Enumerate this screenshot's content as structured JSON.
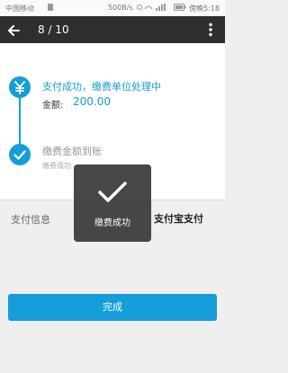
{
  "status_bar": {
    "carrier": "中国移动",
    "network_speed": "500B/s",
    "clock": "傍晚5:18"
  },
  "top_bar": {
    "page_counter": "8 / 10"
  },
  "timeline": {
    "step1_title": "支付成功，缴费单位处理中",
    "step1_amount_label": "金额:",
    "step1_amount_value": "200.00",
    "step2_title": "缴费金额到账",
    "step2_subtitle": "缴费成功"
  },
  "info_row": {
    "label": "支付信息",
    "value": "支付宝支付"
  },
  "toast": {
    "message": "缴费成功"
  },
  "done_button": {
    "label": "完成"
  },
  "colors": {
    "accent": "#149dd8",
    "toolbar": "#2f2f2f"
  }
}
